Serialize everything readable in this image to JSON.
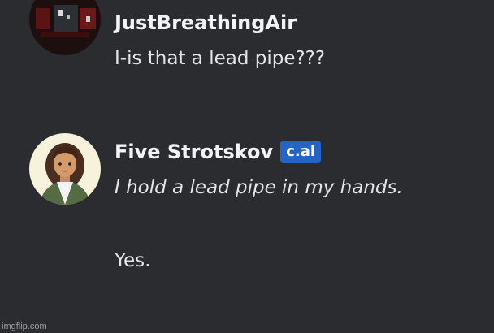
{
  "messages": [
    {
      "author": "JustBreathingAir",
      "lines": [
        "I-is that a lead pipe???"
      ]
    },
    {
      "author": "Five Strotskov",
      "tag": "c.al",
      "lines": [
        "I hold a lead pipe in my hands.",
        "Yes."
      ]
    }
  ],
  "watermark": "imgflip.com",
  "colors": {
    "background": "#2b2c2f",
    "username": "#f2f3f5",
    "text": "#e4e5e7",
    "tag_badge": "#2563c7"
  }
}
